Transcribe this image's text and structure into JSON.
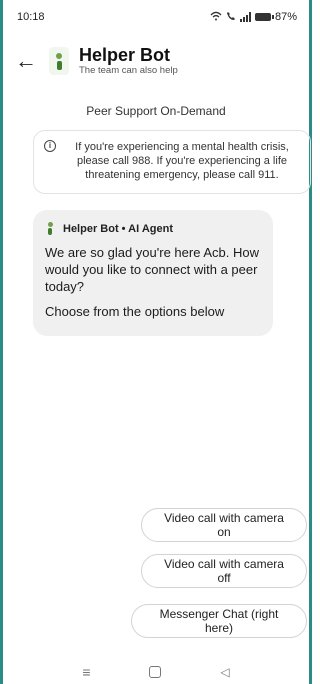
{
  "status_bar": {
    "time": "10:18",
    "battery_percent": "87%",
    "icons": [
      "wifi-icon",
      "call-icon",
      "signal-icon",
      "battery-icon"
    ]
  },
  "header": {
    "back_icon": "arrow-left-icon",
    "title": "Helper Bot",
    "subtitle": "The team can also help"
  },
  "chat": {
    "section_title": "Peer Support On-Demand",
    "crisis_notice": "If you're experiencing a mental health crisis, please call 988. If you're experiencing a life threatening emergency, please call 911.",
    "message": {
      "sender": "Helper Bot • AI Agent",
      "text": "We are so glad you're here Acb. How would you like to connect with a peer today?",
      "prompt": "Choose from the options below"
    }
  },
  "options": [
    {
      "label": "Video call with camera on"
    },
    {
      "label": "Video call with camera off"
    },
    {
      "label": "Messenger Chat (right here)"
    }
  ],
  "nav": {
    "icons": [
      "menu-icon",
      "home-icon",
      "back-icon"
    ]
  },
  "colors": {
    "frame_border": "#2b8c87",
    "bubble_bg": "#f0f0f0",
    "bot_green": "#3f7c2c"
  }
}
